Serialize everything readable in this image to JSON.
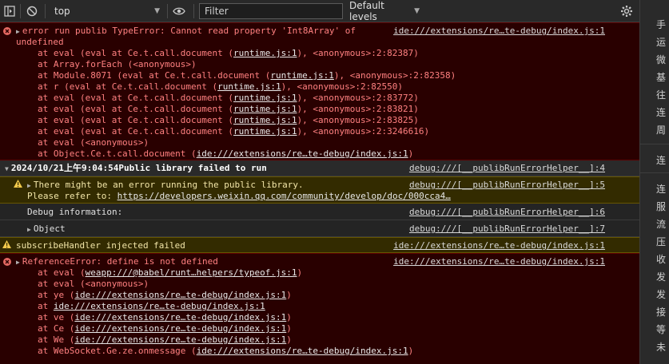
{
  "toolbar": {
    "context": "top",
    "filter_placeholder": "Filter",
    "levels": "Default levels"
  },
  "icons": {
    "sidebar": "sidebar-toggle-icon",
    "clear": "no-entry-icon",
    "eye": "eye-icon",
    "settings": "gear-icon",
    "error": "error-circle-icon",
    "warning": "warning-triangle-icon"
  },
  "colors": {
    "error_bg": "#290000",
    "error_text": "#ff8080",
    "warning_bg": "#332b00",
    "warning_text": "#f2e5a8"
  },
  "messages": {
    "m1": {
      "line1": "error run publib TypeError: Cannot read property 'Int8Array' of",
      "line2": "undefined",
      "src": "ide:///extensions/re…te-debug/index.js:1",
      "f1a": "at eval (eval at Ce.t.call.document (",
      "f1l": "runtime.js:1",
      "f1b": "), <anonymous>:2:82387)",
      "f2": "at Array.forEach (<anonymous>)",
      "f3a": "at Module.8071 (eval at Ce.t.call.document (",
      "f3l": "runtime.js:1",
      "f3b": "), <anonymous>:2:82358)",
      "f4a": "at r (eval at Ce.t.call.document (",
      "f4l": "runtime.js:1",
      "f4b": "), <anonymous>:2:82550)",
      "f5a": "at eval (eval at Ce.t.call.document (",
      "f5l": "runtime.js:1",
      "f5b": "), <anonymous>:2:83772)",
      "f6a": "at eval (eval at Ce.t.call.document (",
      "f6l": "runtime.js:1",
      "f6b": "), <anonymous>:2:83821)",
      "f7a": "at eval (eval at Ce.t.call.document (",
      "f7l": "runtime.js:1",
      "f7b": "), <anonymous>:2:83825)",
      "f8a": "at eval (eval at Ce.t.call.document (",
      "f8l": "runtime.js:1",
      "f8b": "), <anonymous>:2:3246616)",
      "f9": "at eval (<anonymous>)",
      "f10a": "at Object.Ce.t.call.document (",
      "f10l": "ide:///extensions/re…te-debug/index.js:1",
      "f10b": ")"
    },
    "m2": {
      "text": "2024/10/21上午9:04:54Public library failed to run",
      "src": "debug:///[__publibRunErrorHelper__]:4"
    },
    "m3": {
      "line1": "There might be an error running the public library.",
      "line2a": "Please refer to: ",
      "line2l": "https://developers.weixin.qq.com/community/develop/doc/000cca4…",
      "src": "debug:///[__publibRunErrorHelper__]:5"
    },
    "m4": {
      "text": "Debug information:",
      "src": "debug:///[__publibRunErrorHelper__]:6"
    },
    "m5": {
      "text": "Object",
      "src": "debug:///[__publibRunErrorHelper__]:7"
    },
    "m6": {
      "text": "subscribeHandler injected failed",
      "src": "ide:///extensions/re…te-debug/index.js:1"
    },
    "m7": {
      "line1": "ReferenceError: define is not defined",
      "src": "ide:///extensions/re…te-debug/index.js:1",
      "f1a": "at eval (",
      "f1l": "weapp:///@babel/runt…helpers/typeof.js:1",
      "f1b": ")",
      "f2": "at eval (<anonymous>)",
      "f3a": "at ye (",
      "f3l": "ide:///extensions/re…te-debug/index.js:1",
      "f3b": ")",
      "f4a": "at ",
      "f4l": "ide:///extensions/re…te-debug/index.js:1",
      "f4b": "",
      "f5a": "at ve (",
      "f5l": "ide:///extensions/re…te-debug/index.js:1",
      "f5b": ")",
      "f6a": "at Ce (",
      "f6l": "ide:///extensions/re…te-debug/index.js:1",
      "f6b": ")",
      "f7a": "at We (",
      "f7l": "ide:///extensions/re…te-debug/index.js:1",
      "f7b": ")",
      "f8a": "at WebSocket.Ge.ze.onmessage (",
      "f8l": "ide:///extensions/re…te-debug/index.js:1",
      "f8b": ")"
    }
  },
  "right_panel": [
    "手",
    "运",
    "微",
    "基",
    "往",
    "连",
    "周",
    "连",
    "连",
    "服",
    "流",
    "压",
    "收",
    "发",
    "发",
    "接",
    "等",
    "未"
  ]
}
